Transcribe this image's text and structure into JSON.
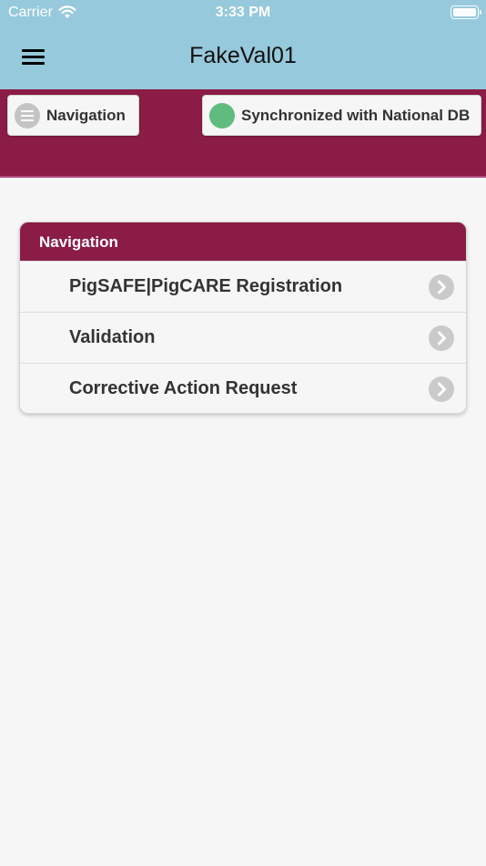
{
  "status_bar": {
    "carrier": "Carrier",
    "time": "3:33 PM"
  },
  "app_bar": {
    "title": "FakeVal01",
    "menu_icon": "hamburger-icon"
  },
  "header_band": {
    "navigation_button": "Navigation",
    "sync_status": "Synchronized with National DB",
    "sync_color": "#5fbb7e"
  },
  "nav_card": {
    "title": "Navigation",
    "items": [
      {
        "label": "PigSAFE|PigCARE Registration"
      },
      {
        "label": "Validation"
      },
      {
        "label": "Corrective Action Request"
      }
    ]
  },
  "colors": {
    "brand": "#8b1c45",
    "top_bar": "#96c9dc",
    "background": "#f6f6f6"
  }
}
